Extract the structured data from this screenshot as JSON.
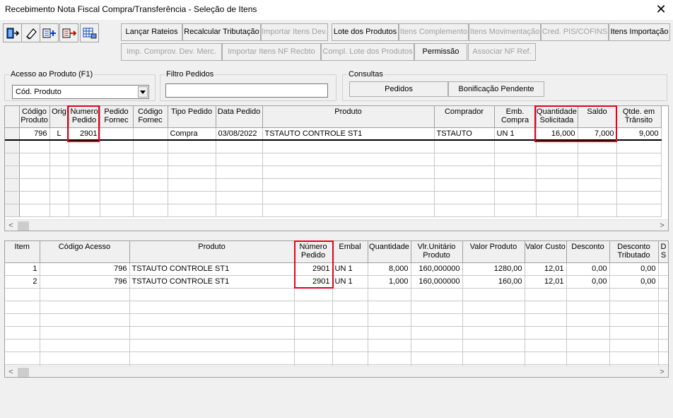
{
  "window": {
    "title": "Recebimento Nota Fiscal Compra/Transferência - Seleção de Itens",
    "close": "✕"
  },
  "toolbar": {
    "row1": [
      {
        "label": "Lançar Rateios",
        "enabled": true
      },
      {
        "label": "Recalcular Tributação",
        "enabled": true
      },
      {
        "label": "Importar Itens Dev.",
        "enabled": false
      },
      {
        "label": "Lote dos Produtos",
        "enabled": true
      },
      {
        "label": "Itens Complemento",
        "enabled": false
      },
      {
        "label": "Itens Movimentação",
        "enabled": false
      },
      {
        "label": "Cred. PIS/COFINS",
        "enabled": false
      },
      {
        "label": "Itens Importação",
        "enabled": true
      }
    ],
    "row2": [
      {
        "label": "Imp. Comprov. Dev. Merc.",
        "enabled": false
      },
      {
        "label": "Importar Itens NF Recbto",
        "enabled": false
      },
      {
        "label": "Compl. Lote dos Produtos",
        "enabled": false
      },
      {
        "label": "Permissão",
        "enabled": true
      },
      {
        "label": "Associar NF Ref.",
        "enabled": false
      }
    ]
  },
  "filters": {
    "acesso_label": "Acesso ao Produto (F1)",
    "acesso_value": "Cód. Produto",
    "filtro_label": "Filtro Pedidos",
    "filtro_value": "",
    "consultas_label": "Consultas",
    "pedidos_button": "Pedidos",
    "bonificacao_button": "Bonificação Pendente"
  },
  "top_grid": {
    "columns": [
      "",
      "Código Produto",
      "Orig",
      "Numero Pedido",
      "Pedido Fornec",
      "Código Fornec",
      "Tipo Pedido",
      "Data Pedido",
      "Produto",
      "Comprador",
      "Emb. Compra",
      "Quantidade Solicitada",
      "Saldo",
      "Qtde. em Trânsito"
    ],
    "rows": [
      [
        "",
        "796",
        "L",
        "2901",
        "",
        "",
        "Compra",
        "03/08/2022",
        "TSTAUTO CONTROLE ST1",
        "TSTAUTO",
        "UN  1",
        "16,000",
        "7,000",
        "9,000"
      ]
    ],
    "empty_rows": 6
  },
  "bottom_grid": {
    "columns": [
      "Item",
      "Código Acesso",
      "Produto",
      "Número Pedido",
      "Embal",
      "Quantidade",
      "Vlr.Unitário Produto",
      "Valor Produto",
      "Valor Custo",
      "Desconto",
      "Desconto Tributado",
      "D S"
    ],
    "rows": [
      [
        "1",
        "796",
        "TSTAUTO CONTROLE ST1",
        "2901",
        "UN  1",
        "8,000",
        "160,000000",
        "1280,00",
        "12,01",
        "0,00",
        "0,00",
        ""
      ],
      [
        "2",
        "796",
        "TSTAUTO CONTROLE ST1",
        "2901",
        "UN  1",
        "1,000",
        "160,000000",
        "160,00",
        "12,01",
        "0,00",
        "0,00",
        ""
      ]
    ],
    "empty_rows": 7
  },
  "scroll": {
    "left": "<",
    "right": ">"
  },
  "colors": {
    "highlight": "#e8001a",
    "disabled_text": "#a0a0a0"
  },
  "icons": [
    "exit-door-icon",
    "eraser-icon",
    "add-item-icon",
    "remove-item-icon",
    "grid-table-icon"
  ]
}
